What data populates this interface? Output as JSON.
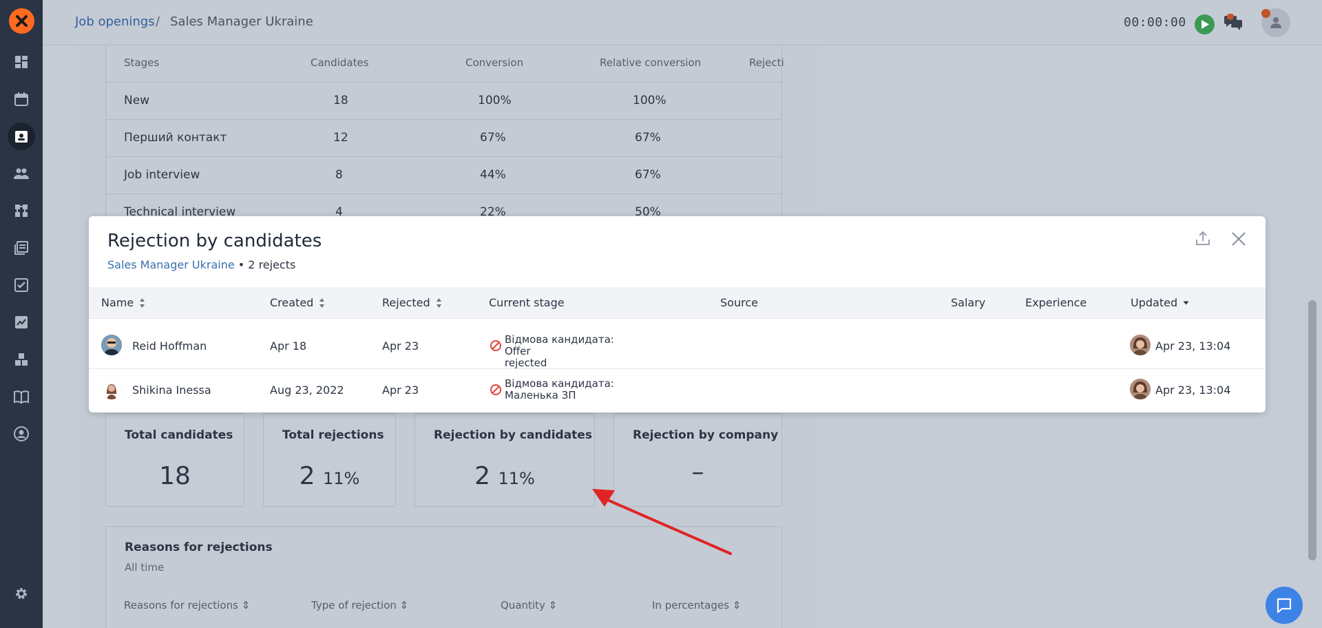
{
  "header": {
    "breadcrumb_link": "Job openings",
    "breadcrumb_separator": "/",
    "breadcrumb_current": "Sales Manager Ukraine",
    "timer": "00:00:00"
  },
  "stages_table": {
    "columns": [
      "Stages",
      "Candidates",
      "Conversion",
      "Relative conversion",
      "Rejecti"
    ],
    "rows": [
      {
        "stage": "New",
        "candidates": "18",
        "conversion": "100%",
        "relative": "100%"
      },
      {
        "stage": "Перший контакт",
        "candidates": "12",
        "conversion": "67%",
        "relative": "67%"
      },
      {
        "stage": "Job interview",
        "candidates": "8",
        "conversion": "44%",
        "relative": "67%"
      },
      {
        "stage": "Technical interview",
        "candidates": "4",
        "conversion": "22%",
        "relative": "50%"
      }
    ]
  },
  "stats": [
    {
      "title": "Total candidates",
      "value": "18",
      "pct": ""
    },
    {
      "title": "Total rejections",
      "value": "2",
      "pct": "11%"
    },
    {
      "title": "Rejection by candidates",
      "value": "2",
      "pct": "11%"
    },
    {
      "title": "Rejection by company",
      "value": "–",
      "pct": ""
    }
  ],
  "reasons": {
    "title": "Reasons for rejections",
    "subtitle": "All time",
    "columns": [
      "Reasons for rejections",
      "Type of rejection",
      "Quantity",
      "In percentages"
    ]
  },
  "modal": {
    "title": "Rejection by candidates",
    "vacancy_link": "Sales Manager Ukraine",
    "reject_count": "• 2 rejects",
    "columns": {
      "name": "Name",
      "created": "Created",
      "rejected": "Rejected",
      "current_stage": "Current stage",
      "source": "Source",
      "salary": "Salary",
      "experience": "Experience",
      "updated": "Updated"
    },
    "rows": [
      {
        "name": "Reid Hoffman",
        "created": "Apr 18",
        "rejected": "Apr 23",
        "stage_line1": "Відмова кандидата: Offer",
        "stage_line2": "rejected",
        "updated": "Apr 23, 13:04"
      },
      {
        "name": "Shikina Inessa",
        "created": "Aug 23, 2022",
        "rejected": "Apr 23",
        "stage_line1": "Відмова кандидата:",
        "stage_line2": "Маленька ЗП",
        "updated": "Apr 23, 13:04"
      }
    ]
  },
  "colors": {
    "accent": "#ff6a1f",
    "link": "#3a6eb0",
    "reject": "#e0463c",
    "help": "#3d82e6"
  }
}
